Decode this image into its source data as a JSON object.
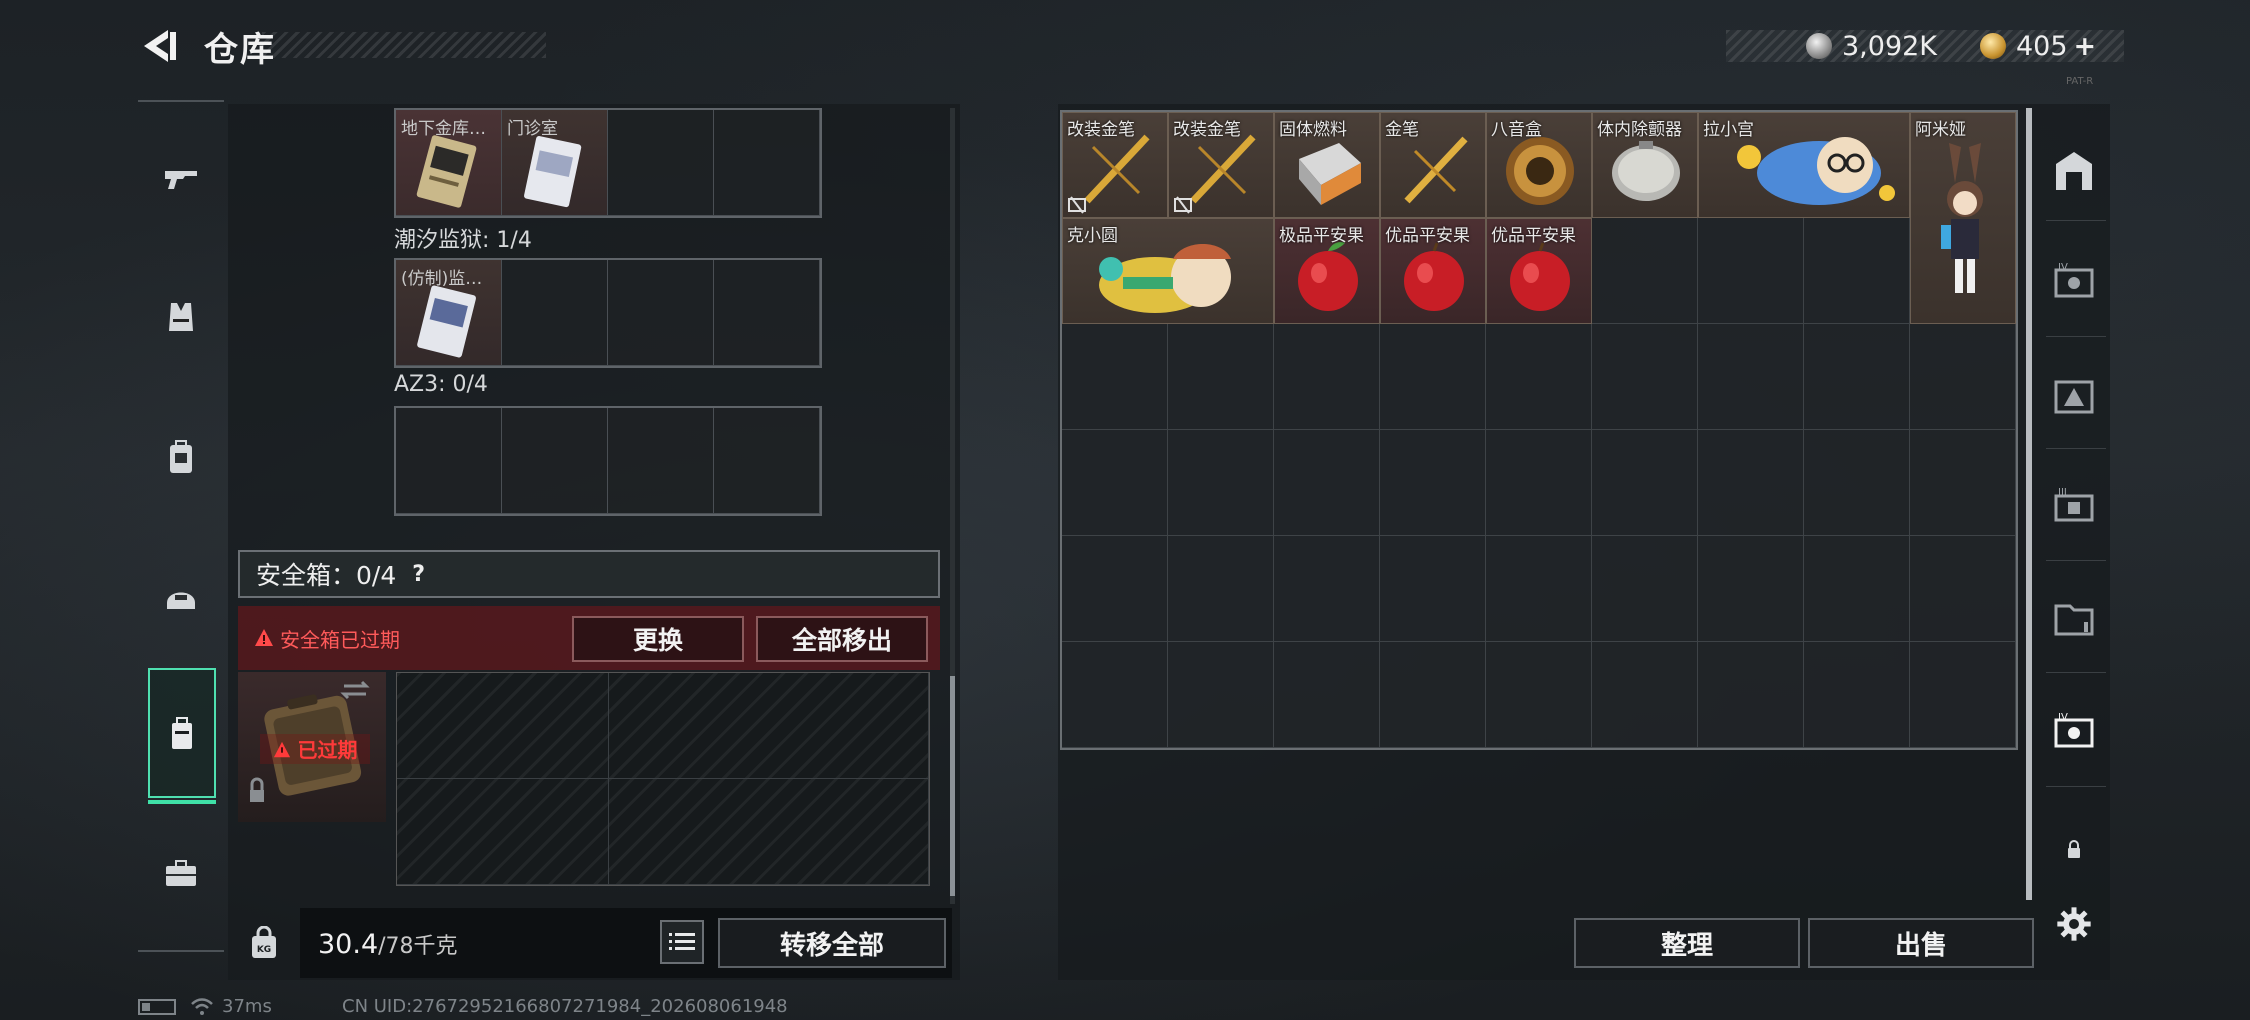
{
  "header": {
    "title": "仓库",
    "silver": "3,092K",
    "gold": "405",
    "gold_plus": "+",
    "tiny": "PAT-R"
  },
  "left_nav": [
    {
      "name": "weapon",
      "icon": "gun-icon"
    },
    {
      "name": "armor",
      "icon": "vest-icon"
    },
    {
      "name": "backpack",
      "icon": "backpack-icon"
    },
    {
      "name": "helmet",
      "icon": "helmet-icon"
    },
    {
      "name": "safe-box",
      "icon": "safe-box-icon",
      "active": true
    },
    {
      "name": "case",
      "icon": "briefcase-icon"
    }
  ],
  "keys_section": {
    "top_items": [
      "地下金库…",
      "门诊室"
    ],
    "tide_prison": {
      "label": "潮汐监狱: 1/4",
      "items": [
        "(仿制)监…"
      ]
    },
    "az3": {
      "label": "AZ3: 0/4"
    }
  },
  "safe": {
    "title": "安全箱：0/4",
    "help": "?",
    "alert": "安全箱已过期",
    "replace": "更换",
    "remove_all": "全部移出",
    "expired": "已过期"
  },
  "weight": {
    "value": "30.4",
    "max": "/78千克"
  },
  "bottom_left": {
    "transfer": "转移全部"
  },
  "stash_items": [
    {
      "label": "改装金笔"
    },
    {
      "label": "改装金笔"
    },
    {
      "label": "固体燃料"
    },
    {
      "label": "金笔"
    },
    {
      "label": "八音盒"
    },
    {
      "label": "体内除颤器"
    },
    {
      "label": "拉小宫"
    },
    {
      "label": "阿米娅"
    },
    {
      "label": "克小圆"
    },
    {
      "label": "极品平安果"
    },
    {
      "label": "优品平安果"
    },
    {
      "label": "优品平安果"
    }
  ],
  "right_buttons": {
    "organize": "整理",
    "sell": "出售"
  },
  "status": {
    "ping": "37ms",
    "uid": "CN UID:2767295216680727198​4_202608061948"
  },
  "colors": {
    "accent": "#3fe0a7",
    "alert": "#ff5a5a",
    "alert_bg": "#78141a"
  }
}
